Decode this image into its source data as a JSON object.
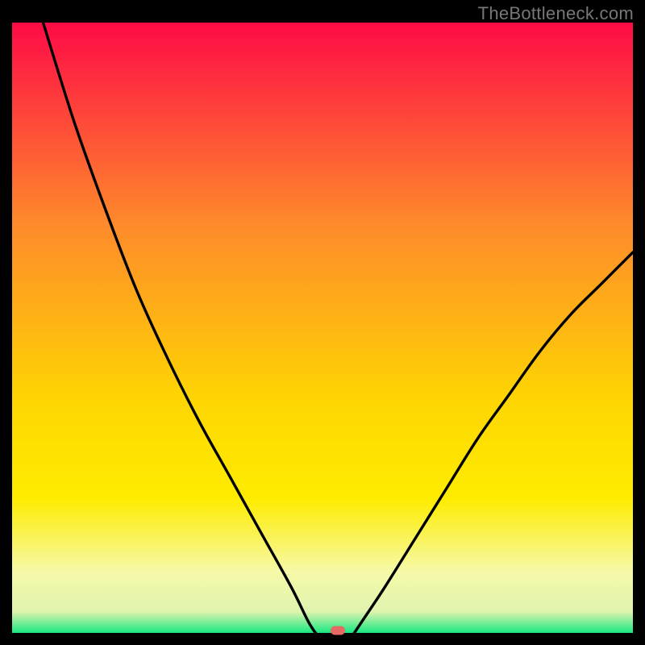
{
  "watermark": "TheBottleneck.com",
  "colors": {
    "top": "#fe0b46",
    "upper_mid": "#fe8a2b",
    "mid": "#fed602",
    "lower_mid": "#feec00",
    "pale": "#f6f9a8",
    "green": "#17e880",
    "marker": "#e66a63",
    "curve": "#000000"
  },
  "chart_data": {
    "type": "line",
    "title": "",
    "xlabel": "",
    "ylabel": "",
    "xlim": [
      0,
      100
    ],
    "ylim": [
      0,
      100
    ],
    "series": [
      {
        "name": "bottleneck-curve-left",
        "x": [
          5,
          10,
          15,
          20,
          25,
          30,
          35,
          40,
          45,
          48,
          50,
          51
        ],
        "y": [
          100,
          84,
          70,
          57,
          46,
          36,
          27,
          18,
          9,
          3,
          0.5,
          0
        ]
      },
      {
        "name": "bottleneck-curve-right",
        "x": [
          54,
          56,
          60,
          65,
          70,
          75,
          80,
          85,
          90,
          95,
          100
        ],
        "y": [
          0,
          3,
          9,
          17,
          25,
          33,
          40,
          47,
          53,
          58,
          63
        ]
      }
    ],
    "marker": {
      "x": 52.5,
      "y": 0
    },
    "gradient_stops": [
      {
        "pct": 0,
        "color": "#fe0b46"
      },
      {
        "pct": 33,
        "color": "#fe8a2b"
      },
      {
        "pct": 62,
        "color": "#fed602"
      },
      {
        "pct": 78,
        "color": "#feec00"
      },
      {
        "pct": 90,
        "color": "#f6f9a8"
      },
      {
        "pct": 96.5,
        "color": "#dff4af"
      },
      {
        "pct": 100,
        "color": "#17e880"
      }
    ]
  }
}
